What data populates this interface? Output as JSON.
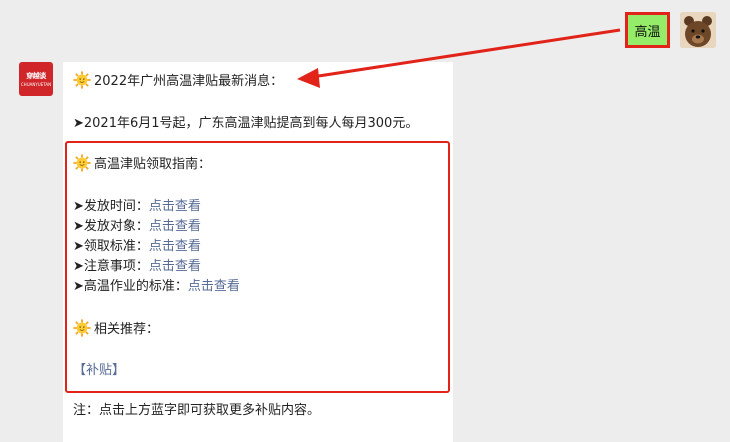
{
  "user": {
    "message": "高温",
    "avatar_icon": "bear-avatar-icon"
  },
  "bot": {
    "avatar_text": "穿越谈",
    "avatar_subtext": "CHUANYUETAN",
    "title": "2022年广州高温津贴最新消息：",
    "policy": "➤2021年6月1号起，广东高温津贴提高到每人每月300元。",
    "guide_title": "高温津贴领取指南：",
    "guide_items": [
      {
        "label": "➤发放时间：",
        "link": "点击查看"
      },
      {
        "label": "➤发放对象：",
        "link": "点击查看"
      },
      {
        "label": "➤领取标准：",
        "link": "点击查看"
      },
      {
        "label": "➤注意事项：",
        "link": "点击查看"
      },
      {
        "label": "➤高温作业的标准：",
        "link": "点击查看"
      }
    ],
    "recommend_title": "相关推荐：",
    "recommend_link": "【补贴】",
    "note": "注：点击上方蓝字即可获取更多补贴内容。"
  },
  "colors": {
    "user_bubble": "#95ec69",
    "highlight_red": "#e2231a",
    "link_blue": "#576b95"
  }
}
